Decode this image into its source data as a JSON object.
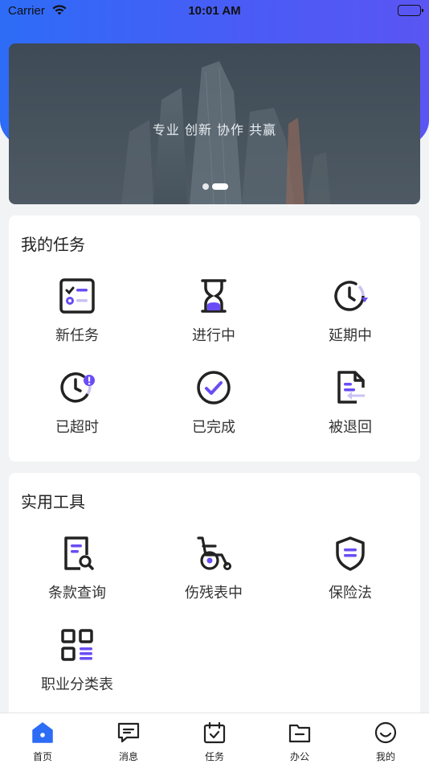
{
  "status_bar": {
    "carrier": "Carrier",
    "time": "10:01 AM"
  },
  "banner": {
    "slogan": "专业 创新 协作 共赢"
  },
  "tasks": {
    "title": "我的任务",
    "items": [
      {
        "label": "新任务",
        "icon": "checklist-icon"
      },
      {
        "label": "进行中",
        "icon": "hourglass-icon"
      },
      {
        "label": "延期中",
        "icon": "clock-delay-icon"
      },
      {
        "label": "已超时",
        "icon": "clock-alert-icon"
      },
      {
        "label": "已完成",
        "icon": "check-circle-icon"
      },
      {
        "label": "被退回",
        "icon": "document-return-icon"
      }
    ]
  },
  "tools": {
    "title": "实用工具",
    "items": [
      {
        "label": "条款查询",
        "icon": "document-search-icon"
      },
      {
        "label": "伤残表中",
        "icon": "wheelchair-icon"
      },
      {
        "label": "保险法",
        "icon": "shield-icon"
      },
      {
        "label": "职业分类表",
        "icon": "grid-list-icon"
      }
    ]
  },
  "tabbar": {
    "items": [
      {
        "label": "首页",
        "icon": "home-icon",
        "active": true
      },
      {
        "label": "消息",
        "icon": "message-icon"
      },
      {
        "label": "任务",
        "icon": "calendar-task-icon"
      },
      {
        "label": "办公",
        "icon": "folder-icon"
      },
      {
        "label": "我的",
        "icon": "smile-profile-icon"
      }
    ]
  },
  "colors": {
    "accent": "#6a4df5",
    "primary_blue": "#2d6cf6",
    "icon_dark": "#222222"
  }
}
